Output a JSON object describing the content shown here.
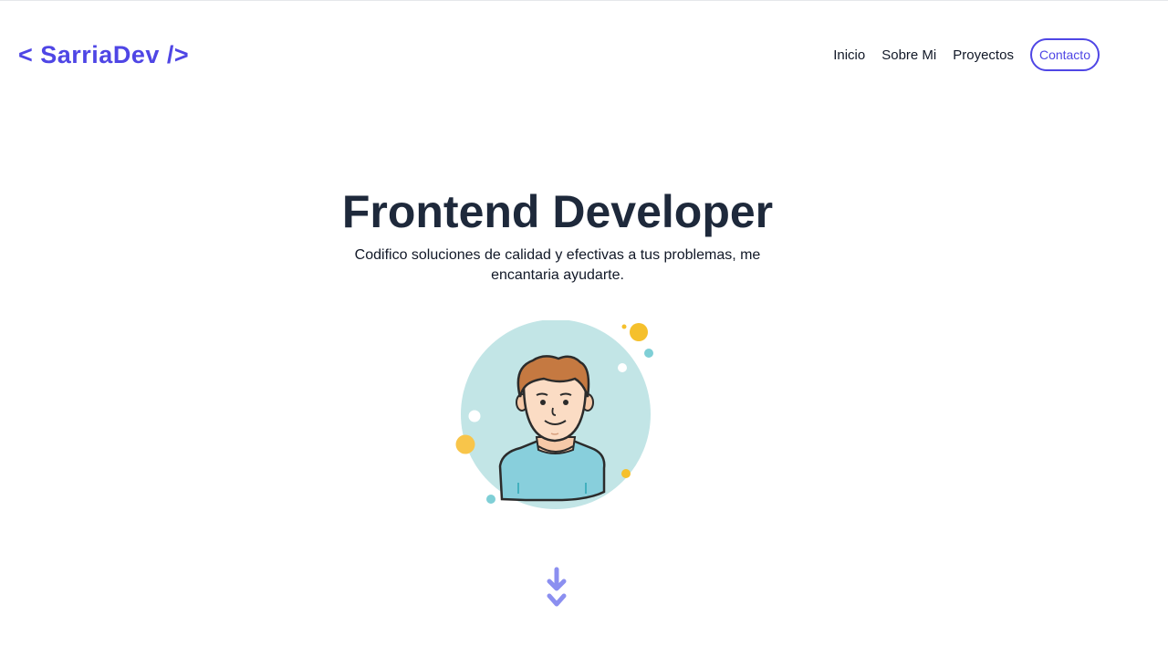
{
  "header": {
    "logo": "< SarriaDev />",
    "nav": {
      "inicio": "Inicio",
      "sobre_mi": "Sobre Mi",
      "proyectos": "Proyectos",
      "contacto": "Contacto"
    }
  },
  "hero": {
    "title": "Frontend Developer",
    "subtitle": "Codifico soluciones de calidad y efectivas a tus problemas, me encantaria ayudarte."
  },
  "icons": {
    "avatar": "developer-avatar-illustration",
    "scroll": "double-arrow-down-icon"
  },
  "colors": {
    "accent": "#4f46e5",
    "title": "#1e293b",
    "avatar_bg": "#c2e5e6",
    "arrow": "#8b8ff0"
  }
}
